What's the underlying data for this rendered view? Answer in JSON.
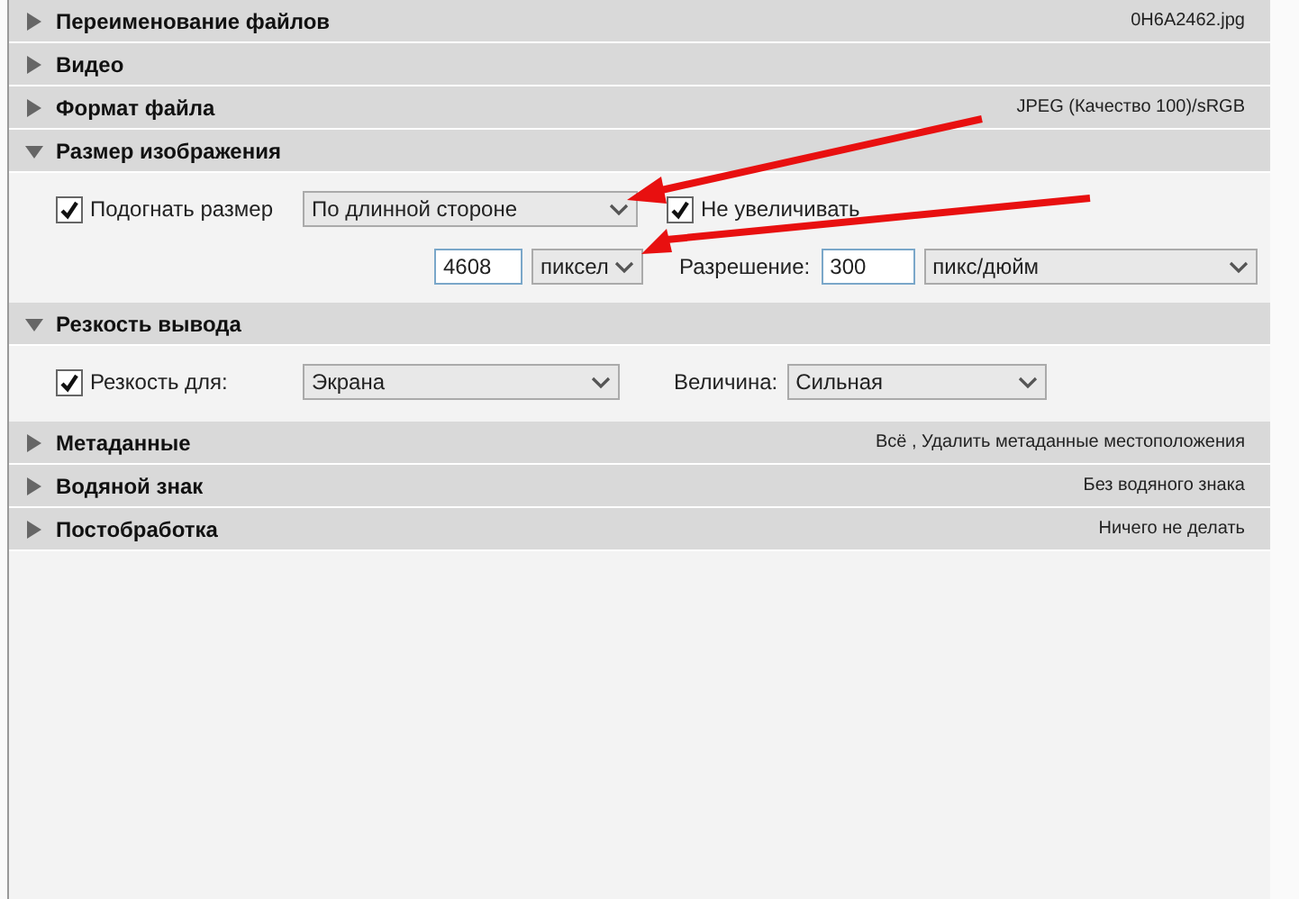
{
  "sections": [
    {
      "title": "Переименование файлов",
      "value": "0H6A2462.jpg",
      "expanded": false
    },
    {
      "title": "Видео",
      "expanded": false
    },
    {
      "title": "Формат файла",
      "value": "JPEG (Качество 100)/sRGB",
      "expanded": false
    },
    {
      "title": "Размер изображения",
      "expanded": true,
      "kind": "image_size",
      "fit": {
        "label": "Подогнать размер",
        "checked": true
      },
      "fit_mode": "По длинной стороне",
      "no_enlarge": {
        "label": "Не увеличивать",
        "checked": true
      },
      "size_value": "4608",
      "size_unit": "пиксел",
      "resolution_label": "Разрешение:",
      "resolution_value": "300",
      "resolution_unit": "пикс/дюйм"
    },
    {
      "title": "Резкость вывода",
      "expanded": true,
      "kind": "sharpening",
      "sharpen": {
        "label": "Резкость для:",
        "checked": true
      },
      "target": "Экрана",
      "amount_label": "Величина:",
      "amount": "Сильная"
    },
    {
      "title": "Метаданные",
      "value": "Всё , Удалить метаданные местоположения",
      "expanded": false
    },
    {
      "title": "Водяной знак",
      "value": "Без водяного знака",
      "expanded": false
    },
    {
      "title": "Постобработка",
      "value": "Ничего не делать",
      "expanded": false
    }
  ]
}
